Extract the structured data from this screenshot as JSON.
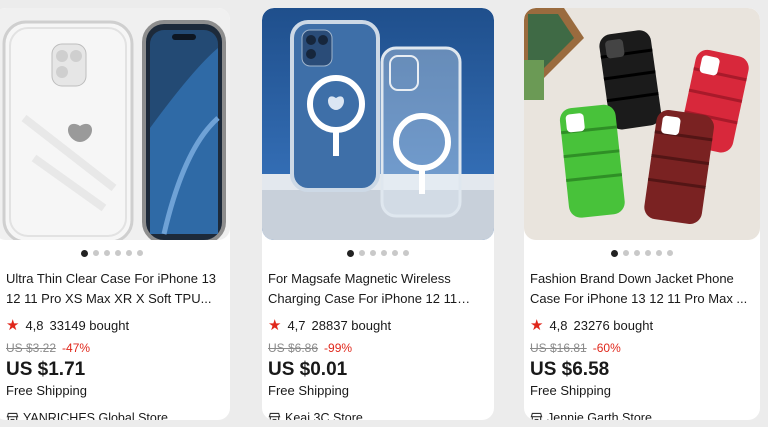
{
  "products": [
    {
      "title": "Ultra Thin Clear Case For iPhone 13 12 11 Pro XS Max XR X Soft TPU...",
      "rating": "4,8",
      "sold": "33149 bought",
      "original_price": "US $3.22",
      "discount": "-47%",
      "price": "US $1.71",
      "shipping": "Free Shipping",
      "store": "YANRICHES Global Store",
      "image_icon": "clear-phone-case-image",
      "dot_count": 6,
      "active_dot": 0
    },
    {
      "title": "For Magsafe Magnetic Wireless Charging Case For iPhone 12 11 13...",
      "rating": "4,7",
      "sold": "28837 bought",
      "original_price": "US $6.86",
      "discount": "-99%",
      "price": "US $0.01",
      "shipping": "Free Shipping",
      "store": "Keai 3C Store",
      "image_icon": "magsafe-case-image",
      "dot_count": 6,
      "active_dot": 0
    },
    {
      "title": "Fashion Brand Down Jacket Phone Case For iPhone 13 12 11 Pro Max ...",
      "rating": "4,8",
      "sold": "23276 bought",
      "original_price": "US $16.81",
      "discount": "-60%",
      "price": "US $6.58",
      "shipping": "Free Shipping",
      "store": "Jennie Garth Store",
      "image_icon": "puffer-case-image",
      "dot_count": 6,
      "active_dot": 0
    }
  ],
  "icons": {
    "star": "★",
    "store": "store-icon"
  },
  "colors": {
    "accent_red": "#e0271b",
    "strike_gray": "#8a8a8a",
    "card_bg": "#ffffff",
    "page_bg": "#ececec"
  }
}
